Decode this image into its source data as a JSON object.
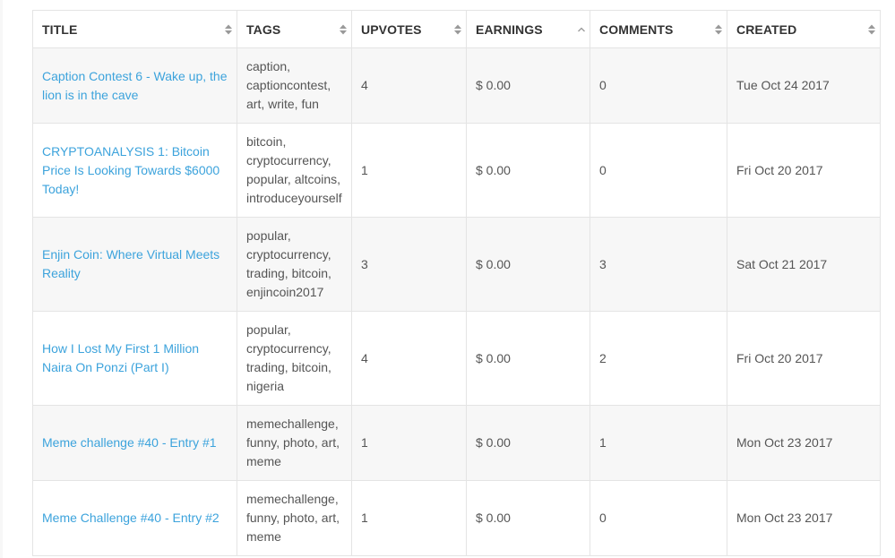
{
  "table": {
    "headers": [
      {
        "label": "TITLE",
        "sort": "both"
      },
      {
        "label": "TAGS",
        "sort": "both"
      },
      {
        "label": "UPVOTES",
        "sort": "both"
      },
      {
        "label": "EARNINGS",
        "sort": "asc"
      },
      {
        "label": "COMMENTS",
        "sort": "both"
      },
      {
        "label": "CREATED",
        "sort": "both"
      }
    ],
    "rows": [
      {
        "title": "Caption Contest 6 - Wake up, the lion is in the cave",
        "tags": [
          "caption,",
          "captioncontest,",
          "art, write, fun"
        ],
        "upvotes": "4",
        "earnings": "$ 0.00",
        "comments": "0",
        "created": "Tue Oct 24 2017"
      },
      {
        "title": "CRYPTOANALYSIS 1: Bitcoin Price Is Looking Towards $6000 Today!",
        "tags": [
          "bitcoin,",
          "cryptocurrency,",
          "popular, altcoins,",
          "introduceyourself"
        ],
        "upvotes": "1",
        "earnings": "$ 0.00",
        "comments": "0",
        "created": "Fri Oct 20 2017"
      },
      {
        "title": "Enjin Coin: Where Virtual Meets Reality",
        "tags": [
          "popular,",
          "cryptocurrency,",
          "trading, bitcoin,",
          "enjincoin2017"
        ],
        "upvotes": "3",
        "earnings": "$ 0.00",
        "comments": "3",
        "created": "Sat Oct 21 2017"
      },
      {
        "title": "How I Lost My First 1 Million Naira On Ponzi (Part I)",
        "tags": [
          "popular,",
          "cryptocurrency,",
          "trading, bitcoin,",
          "nigeria"
        ],
        "upvotes": "4",
        "earnings": "$ 0.00",
        "comments": "2",
        "created": "Fri Oct 20 2017"
      },
      {
        "title": "Meme challenge #40 - Entry #1",
        "tags": [
          "memechallenge,",
          "funny, photo, art,",
          "meme"
        ],
        "upvotes": "1",
        "earnings": "$ 0.00",
        "comments": "1",
        "created": "Mon Oct 23 2017"
      },
      {
        "title": "Meme Challenge #40 - Entry #2",
        "tags": [
          "memechallenge,",
          "funny, photo, art,",
          "meme"
        ],
        "upvotes": "1",
        "earnings": "$ 0.00",
        "comments": "0",
        "created": "Mon Oct 23 2017"
      }
    ]
  },
  "colors": {
    "link": "#3ca3dc",
    "text": "#555555",
    "header_text": "#333333",
    "border": "#e4e4e4",
    "row_stripe": "#f7f7f7",
    "sort_icon": "#999999"
  }
}
